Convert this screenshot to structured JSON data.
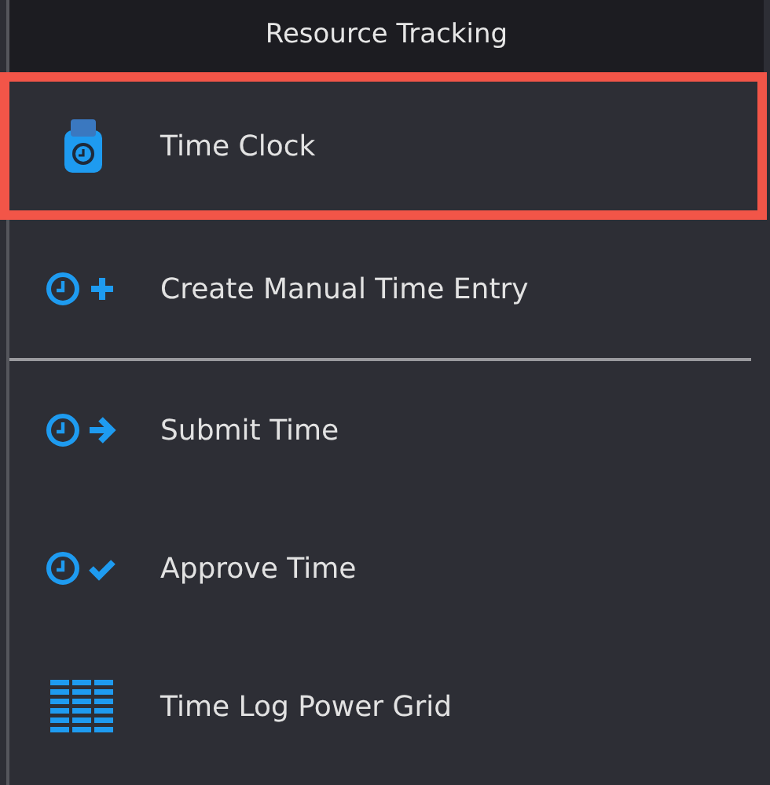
{
  "menu": {
    "title": "Resource Tracking",
    "items": [
      {
        "kind": "item",
        "label": "Time Clock",
        "highlighted": true
      },
      {
        "kind": "item",
        "label": "Create Manual Time Entry",
        "highlighted": false
      },
      {
        "kind": "separator"
      },
      {
        "kind": "item",
        "label": "Submit Time",
        "highlighted": false
      },
      {
        "kind": "item",
        "label": "Approve Time",
        "highlighted": false
      },
      {
        "kind": "item",
        "label": "Time Log Power Grid",
        "highlighted": false
      }
    ]
  }
}
